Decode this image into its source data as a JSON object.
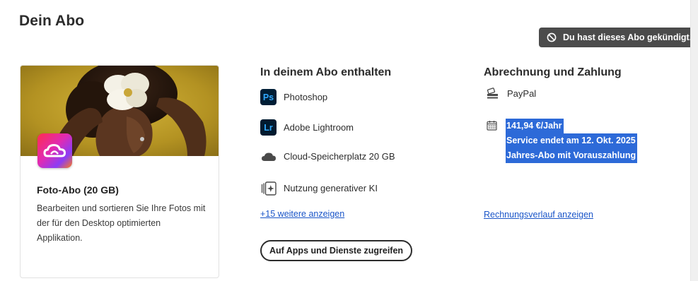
{
  "page": {
    "title": "Dein Abo"
  },
  "status_badge": {
    "label": "Du hast dieses Abo gekündigt.",
    "icon": "blocked-icon"
  },
  "plan_card": {
    "title": "Foto-Abo (20 GB)",
    "description": "Bearbeiten und sortieren Sie Ihre Fotos mit der für den Desktop optimierten Applikation.",
    "logo_icon": "creative-cloud-logo"
  },
  "included": {
    "heading": "In deinem Abo enthalten",
    "items": [
      {
        "label": "Photoshop",
        "icon": "photoshop-icon",
        "badge": "Ps"
      },
      {
        "label": "Adobe Lightroom",
        "icon": "lightroom-icon",
        "badge": "Lr"
      },
      {
        "label": "Cloud-Speicherplatz 20 GB",
        "icon": "cloud-icon"
      },
      {
        "label": "Nutzung generativer KI",
        "icon": "generative-ai-icon"
      }
    ],
    "more_link": "+15 weitere anzeigen",
    "apps_button": "Auf Apps und Dienste zugreifen"
  },
  "billing": {
    "heading": "Abrechnung und Zahlung",
    "payment_method": "PayPal",
    "price": "141,94 €/Jahr",
    "service_end": "Service endet am 12. Okt. 2025",
    "plan_type": "Jahres-Abo mit Vorauszahlung",
    "history_link": "Rechnungsverlauf anzeigen"
  },
  "colors": {
    "badge_bg": "#4b4b4b",
    "link": "#1a55c8",
    "selection": "#2d6ad8",
    "app_tile_bg": "#001e36",
    "app_tile_fg": "#31a8ff"
  }
}
